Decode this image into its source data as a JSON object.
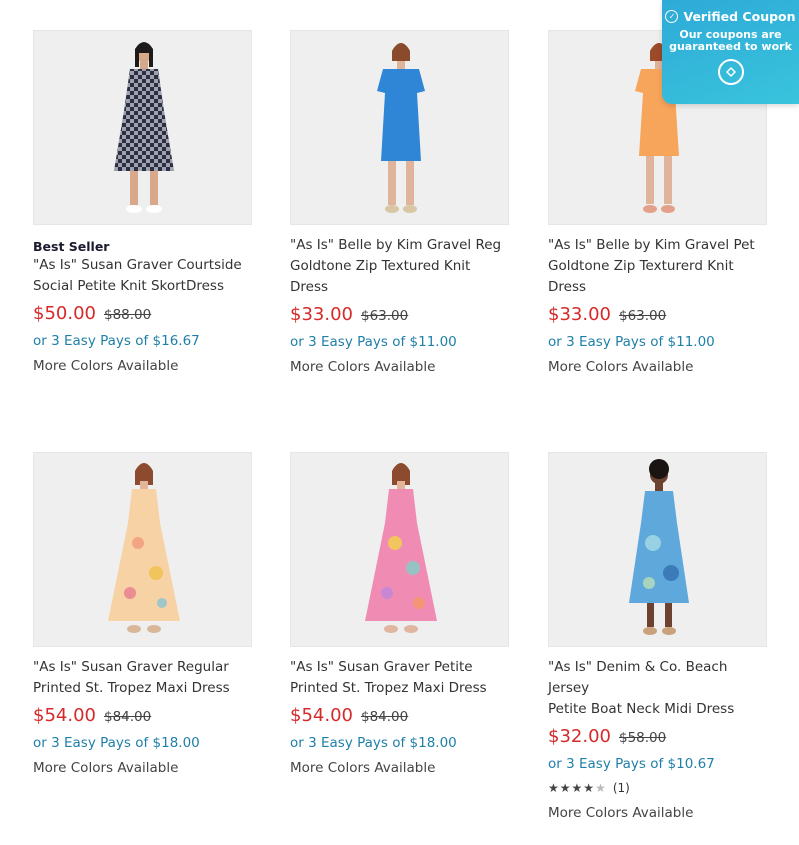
{
  "coupon": {
    "title": "Verified Coupon",
    "subtitle": "Our coupons are guaranteed to work",
    "icon": "coupon-logo-icon"
  },
  "products": [
    {
      "badge": "Best Seller",
      "title_line1": "\"As Is\" Susan Graver Courtside",
      "title_line2": "Social Petite Knit SkortDress",
      "title_line3": "",
      "price": "$50.00",
      "was": "$88.00",
      "pays": "or 3 Easy Pays of $16.67",
      "colors": "More Colors Available",
      "dress_color": "#2b2f45"
    },
    {
      "badge": "",
      "title_line1": "\"As Is\" Belle by Kim Gravel Reg",
      "title_line2": "Goldtone Zip Textured Knit Dress",
      "title_line3": "",
      "price": "$33.00",
      "was": "$63.00",
      "pays": "or 3 Easy Pays of $11.00",
      "colors": "More Colors Available",
      "dress_color": "#2f86d6"
    },
    {
      "badge": "",
      "title_line1": "\"As Is\" Belle by Kim Gravel Pet",
      "title_line2": "Goldtone Zip Texturerd Knit",
      "title_line3": "Dress",
      "price": "$33.00",
      "was": "$63.00",
      "pays": "or 3 Easy Pays of $11.00",
      "colors": "More Colors Available",
      "dress_color": "#f8a55c"
    },
    {
      "badge": "",
      "title_line1": "\"As Is\" Susan Graver Regular",
      "title_line2": "Printed St. Tropez Maxi Dress",
      "title_line3": "",
      "price": "$54.00",
      "was": "$84.00",
      "pays": "or 3 Easy Pays of $18.00",
      "colors": "More Colors Available",
      "dress_color": "#f6d2a4"
    },
    {
      "badge": "",
      "title_line1": "\"As Is\" Susan Graver Petite",
      "title_line2": "Printed St. Tropez Maxi Dress",
      "title_line3": "",
      "price": "$54.00",
      "was": "$84.00",
      "pays": "or 3 Easy Pays of $18.00",
      "colors": "More Colors Available",
      "dress_color": "#f08cb4"
    },
    {
      "badge": "",
      "title_line1": "\"As Is\" Denim & Co. Beach Jersey",
      "title_line2": "Petite Boat Neck Midi Dress",
      "title_line3": "",
      "price": "$32.00",
      "was": "$58.00",
      "pays": "or 3 Easy Pays of $10.67",
      "rating_stars": 4,
      "rating_count": "(1)",
      "colors": "More Colors Available",
      "dress_color": "#5ea8dc"
    }
  ]
}
